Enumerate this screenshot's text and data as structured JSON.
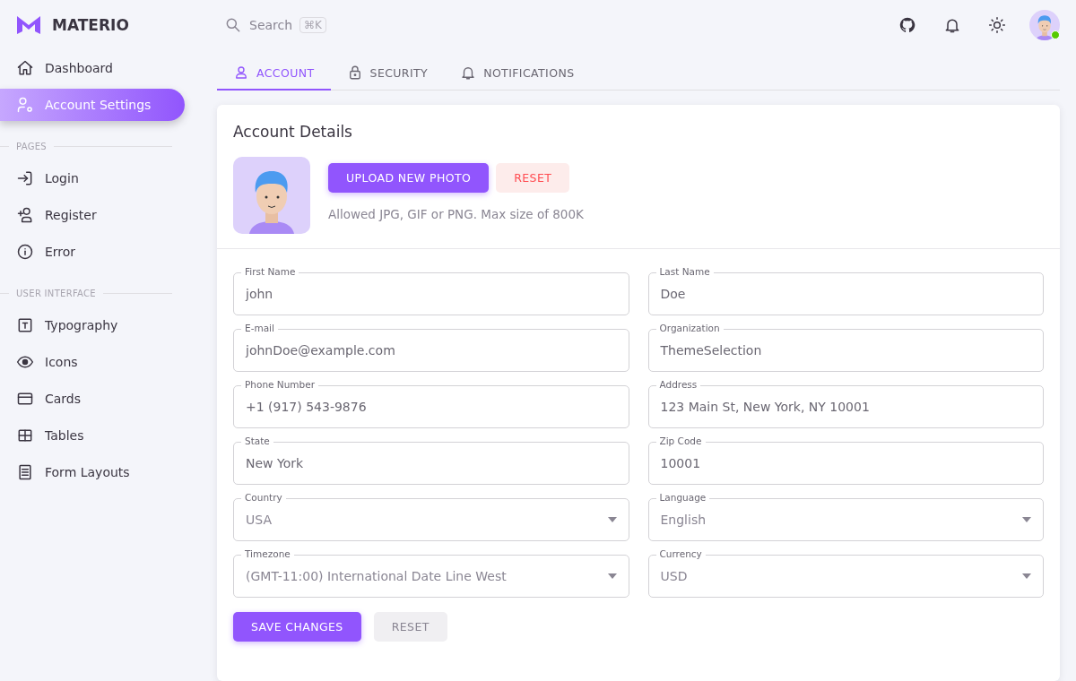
{
  "brand": "MATERIO",
  "search": {
    "placeholder": "Search",
    "shortcut": "⌘K"
  },
  "sidebar": {
    "items": [
      {
        "label": "Dashboard",
        "selected": false
      },
      {
        "label": "Account Settings",
        "selected": true
      }
    ],
    "sections": [
      {
        "title": "PAGES",
        "items": [
          {
            "label": "Login",
            "selected": false
          },
          {
            "label": "Register",
            "selected": false
          },
          {
            "label": "Error",
            "selected": false
          }
        ]
      },
      {
        "title": "USER INTERFACE",
        "items": [
          {
            "label": "Typography",
            "selected": false
          },
          {
            "label": "Icons",
            "selected": false
          },
          {
            "label": "Cards",
            "selected": false
          },
          {
            "label": "Tables",
            "selected": false
          },
          {
            "label": "Form Layouts",
            "selected": false
          }
        ]
      }
    ]
  },
  "user": {
    "online": true
  },
  "tabs": [
    {
      "label": "ACCOUNT",
      "selected": true
    },
    {
      "label": "SECURITY",
      "selected": false
    },
    {
      "label": "NOTIFICATIONS",
      "selected": false
    }
  ],
  "card": {
    "title": "Account Details",
    "upload_button": "UPLOAD NEW PHOTO",
    "reset_button": "RESET",
    "hint": "Allowed JPG, GIF or PNG. Max size of 800K",
    "fields": [
      {
        "label": "First Name",
        "value": "john",
        "kind": "text"
      },
      {
        "label": "Last Name",
        "value": "Doe",
        "kind": "text"
      },
      {
        "label": "E-mail",
        "value": "johnDoe@example.com",
        "kind": "text"
      },
      {
        "label": "Organization",
        "value": "ThemeSelection",
        "kind": "text"
      },
      {
        "label": "Phone Number",
        "value": "+1 (917) 543-9876",
        "kind": "text"
      },
      {
        "label": "Address",
        "value": "123 Main St, New York, NY 10001",
        "kind": "text"
      },
      {
        "label": "State",
        "value": "New York",
        "kind": "text"
      },
      {
        "label": "Zip Code",
        "value": "10001",
        "kind": "text"
      },
      {
        "label": "Country",
        "value": "USA",
        "kind": "select"
      },
      {
        "label": "Language",
        "value": "English",
        "kind": "select"
      },
      {
        "label": "Timezone",
        "value": "(GMT-11:00) International Date Line West",
        "kind": "select"
      },
      {
        "label": "Currency",
        "value": "USD",
        "kind": "select"
      }
    ],
    "save_button": "SAVE CHANGES",
    "form_reset_button": "RESET"
  }
}
